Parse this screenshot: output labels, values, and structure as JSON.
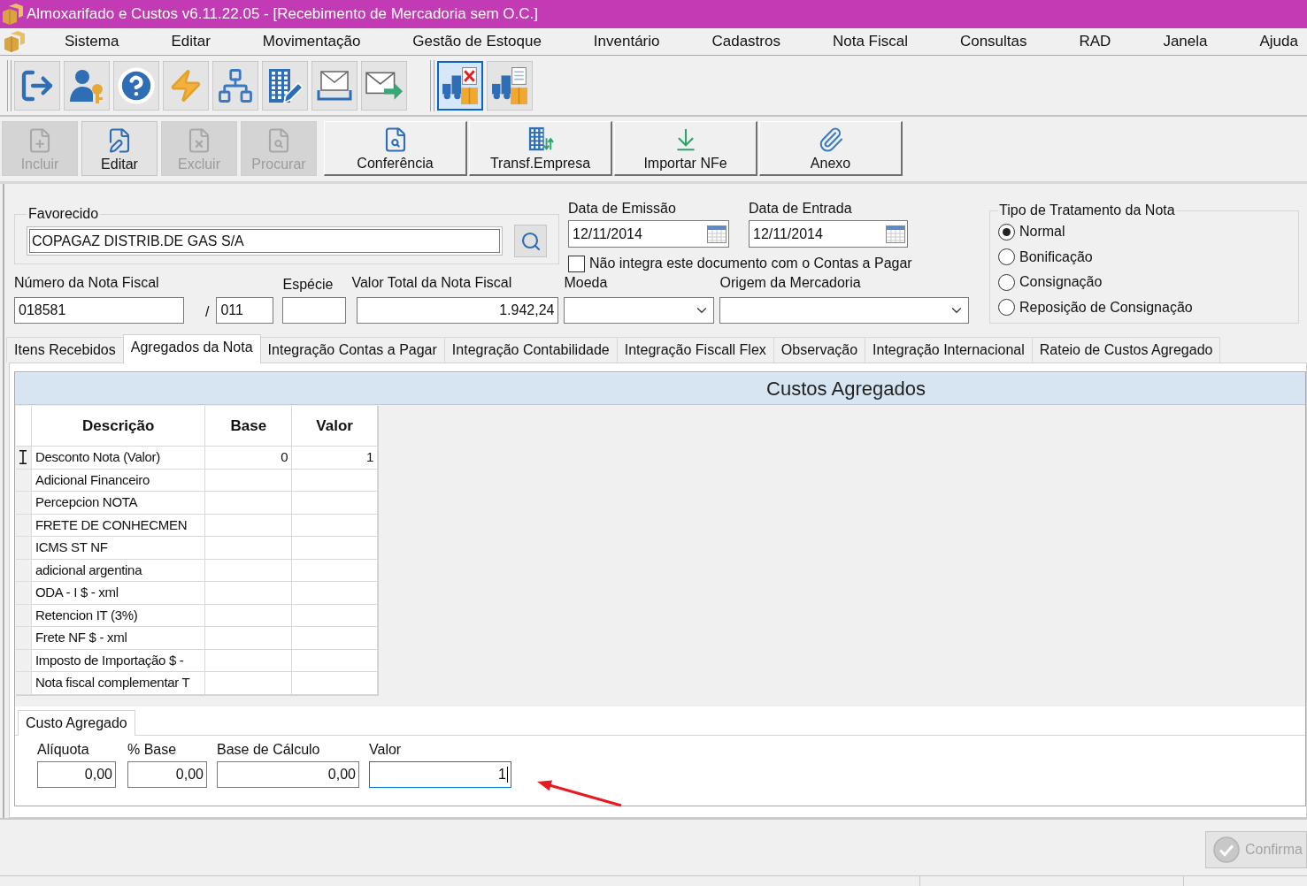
{
  "window": {
    "title": "Almoxarifado e Custos v6.11.22.05 - [Recebimento de Mercadoria sem O.C.]"
  },
  "menu": [
    "Sistema",
    "Editar",
    "Movimentação",
    "Gestão de Estoque",
    "Inventário",
    "Cadastros",
    "Nota Fiscal",
    "Consultas",
    "RAD",
    "Janela",
    "Ajuda"
  ],
  "toolbar": {
    "groups": [
      [
        {
          "selected": false
        },
        {
          "selected": false
        },
        {
          "selected": false
        },
        {
          "selected": false
        },
        {
          "selected": false
        },
        {
          "selected": false
        },
        {
          "selected": false
        },
        {
          "selected": false
        }
      ],
      [
        {
          "selected": true
        },
        {
          "selected": false
        }
      ]
    ]
  },
  "actions": [
    {
      "kind": "record",
      "label": "Incluir",
      "disabled": true
    },
    {
      "kind": "record",
      "label": "Editar",
      "disabled": false
    },
    {
      "kind": "record",
      "label": "Excluir",
      "disabled": true
    },
    {
      "kind": "record",
      "label": "Procurar",
      "disabled": true
    },
    {
      "kind": "task",
      "label": "Conferência",
      "disabled": false
    },
    {
      "kind": "task",
      "label": "Transf.Empresa",
      "disabled": false
    },
    {
      "kind": "task",
      "label": "Importar NFe",
      "disabled": false
    },
    {
      "kind": "task",
      "label": "Anexo",
      "disabled": false
    }
  ],
  "form": {
    "favorecido": {
      "label": "Favorecido",
      "value": "COPAGAZ DISTRIB.DE GAS S/A"
    },
    "data_emissao": {
      "label": "Data de Emissão",
      "value": "12/11/2014"
    },
    "data_entrada": {
      "label": "Data de Entrada",
      "value": "12/11/2014"
    },
    "nao_integra": {
      "label": "Não integra este documento com o Contas a Pagar",
      "checked": false
    },
    "numero": {
      "label": "Número da Nota Fiscal",
      "value": "018581"
    },
    "separator": "/",
    "serie": {
      "value": "011"
    },
    "especie": {
      "label": "Espécie"
    },
    "valor_total": {
      "label": "Valor Total da Nota Fiscal",
      "value": "1.942,24"
    },
    "moeda": {
      "label": "Moeda"
    },
    "origem": {
      "label": "Origem da Mercadoria"
    },
    "tipo_tratamento": {
      "label": "Tipo de Tratamento da Nota",
      "options": [
        {
          "label": "Normal",
          "selected": true
        },
        {
          "label": "Bonificação",
          "selected": false
        },
        {
          "label": "Consignação",
          "selected": false
        },
        {
          "label": "Reposição de Consignação",
          "selected": false
        }
      ]
    }
  },
  "tabs": [
    {
      "label": "Itens Recebidos",
      "selected": false
    },
    {
      "label": "Agregados da Nota",
      "selected": true
    },
    {
      "label": "Integração Contas a Pagar",
      "selected": false
    },
    {
      "label": "Integração Contabilidade",
      "selected": false
    },
    {
      "label": "Integração Fiscall Flex",
      "selected": false
    },
    {
      "label": "Observação",
      "selected": false
    },
    {
      "label": "Integração Internacional",
      "selected": false
    },
    {
      "label": "Rateio de Custos Agregado",
      "selected": false
    }
  ],
  "custos_agregados": {
    "title": "Custos Agregados",
    "table": {
      "columns": [
        "Descrição",
        "Base",
        "Valor"
      ],
      "rows": [
        [
          "Desconto Nota (Valor)",
          "0",
          "1"
        ],
        [
          "Adicional Financeiro"
        ],
        [
          "Percepcion NOTA"
        ],
        [
          "FRETE DE CONHECMEN"
        ],
        [
          "ICMS ST NF"
        ],
        [
          "adicional argentina"
        ],
        [
          "ODA - I $ - xml"
        ],
        [
          "Retencion IT (3%)"
        ],
        [
          "Frete NF $ - xml"
        ],
        [
          "Imposto de Importação $ -"
        ],
        [
          "Nota fiscal complementar T"
        ]
      ]
    },
    "custo_agregado": {
      "tab": "Custo Agregado",
      "fields": [
        {
          "label": "Alíquota",
          "value": "0,00",
          "focused": false
        },
        {
          "label": "% Base",
          "value": "0,00",
          "focused": false
        },
        {
          "label": "Base de Cálculo",
          "value": "0,00",
          "focused": false
        },
        {
          "label": "Valor",
          "value": "1",
          "focused": true
        }
      ]
    }
  },
  "footer": {
    "confirm_button": {
      "label": "Confirma",
      "disabled": true
    }
  }
}
